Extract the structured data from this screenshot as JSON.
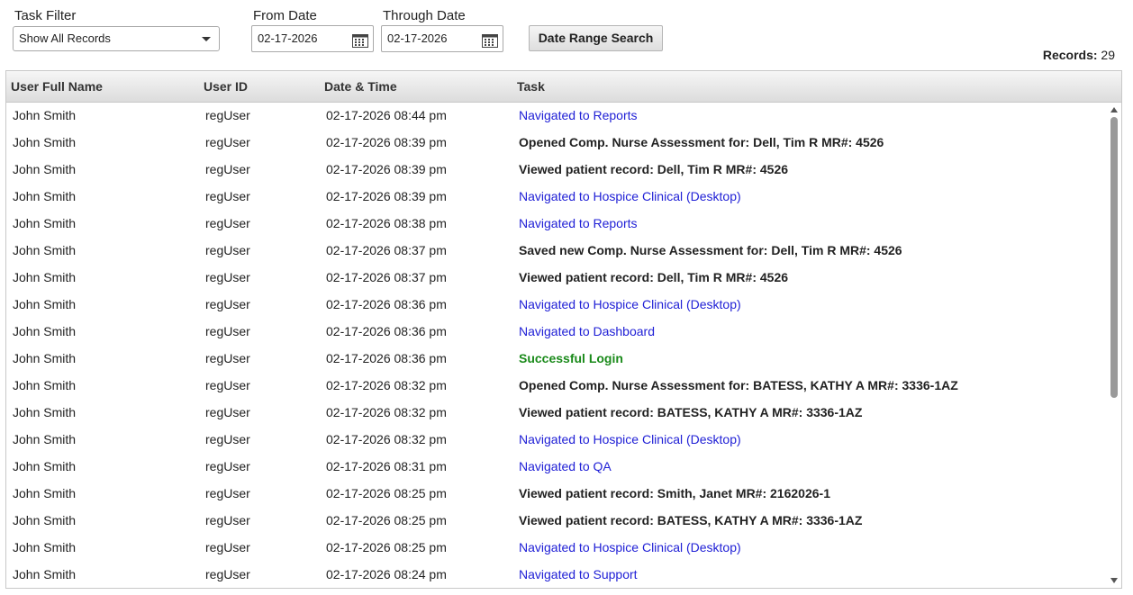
{
  "filters": {
    "task_filter_label": "Task Filter",
    "task_filter_value": "Show All Records",
    "from_date_label": "From Date",
    "from_date_value": "02-17-2026",
    "through_date_label": "Through Date",
    "through_date_value": "02-17-2026",
    "search_button": "Date Range Search"
  },
  "records": {
    "label": "Records:",
    "count": "29"
  },
  "table": {
    "headers": [
      "User Full Name",
      "User ID",
      "Date & Time",
      "Task"
    ],
    "rows": [
      {
        "name": "John Smith",
        "user_id": "regUser",
        "datetime": "02-17-2026 08:44 pm",
        "task": "Navigated to Reports",
        "style": "link"
      },
      {
        "name": "John Smith",
        "user_id": "regUser",
        "datetime": "02-17-2026 08:39 pm",
        "task": "Opened Comp. Nurse Assessment for: Dell, Tim R  MR#: 4526",
        "style": "bold"
      },
      {
        "name": "John Smith",
        "user_id": "regUser",
        "datetime": "02-17-2026 08:39 pm",
        "task": "Viewed patient record: Dell, Tim R  MR#: 4526",
        "style": "bold"
      },
      {
        "name": "John Smith",
        "user_id": "regUser",
        "datetime": "02-17-2026 08:39 pm",
        "task": "Navigated to Hospice Clinical (Desktop)",
        "style": "link"
      },
      {
        "name": "John Smith",
        "user_id": "regUser",
        "datetime": "02-17-2026 08:38 pm",
        "task": "Navigated to Reports",
        "style": "link"
      },
      {
        "name": "John Smith",
        "user_id": "regUser",
        "datetime": "02-17-2026 08:37 pm",
        "task": "Saved new Comp. Nurse Assessment for: Dell, Tim R  MR#: 4526",
        "style": "bold"
      },
      {
        "name": "John Smith",
        "user_id": "regUser",
        "datetime": "02-17-2026 08:37 pm",
        "task": "Viewed patient record: Dell, Tim R  MR#: 4526",
        "style": "bold"
      },
      {
        "name": "John Smith",
        "user_id": "regUser",
        "datetime": "02-17-2026 08:36 pm",
        "task": "Navigated to Hospice Clinical (Desktop)",
        "style": "link"
      },
      {
        "name": "John Smith",
        "user_id": "regUser",
        "datetime": "02-17-2026 08:36 pm",
        "task": "Navigated to Dashboard",
        "style": "link"
      },
      {
        "name": "John Smith",
        "user_id": "regUser",
        "datetime": "02-17-2026 08:36 pm",
        "task": "Successful Login",
        "style": "green"
      },
      {
        "name": "John Smith",
        "user_id": "regUser",
        "datetime": "02-17-2026 08:32 pm",
        "task": "Opened Comp. Nurse Assessment for: BATESS, KATHY A  MR#: 3336-1AZ",
        "style": "bold"
      },
      {
        "name": "John Smith",
        "user_id": "regUser",
        "datetime": "02-17-2026 08:32 pm",
        "task": "Viewed patient record: BATESS, KATHY A  MR#: 3336-1AZ",
        "style": "bold"
      },
      {
        "name": "John Smith",
        "user_id": "regUser",
        "datetime": "02-17-2026 08:32 pm",
        "task": "Navigated to Hospice Clinical (Desktop)",
        "style": "link"
      },
      {
        "name": "John Smith",
        "user_id": "regUser",
        "datetime": "02-17-2026 08:31 pm",
        "task": "Navigated to QA",
        "style": "link"
      },
      {
        "name": "John Smith",
        "user_id": "regUser",
        "datetime": "02-17-2026 08:25 pm",
        "task": "Viewed patient record: Smith, Janet  MR#: 2162026-1",
        "style": "bold"
      },
      {
        "name": "John Smith",
        "user_id": "regUser",
        "datetime": "02-17-2026 08:25 pm",
        "task": "Viewed patient record: BATESS, KATHY A  MR#: 3336-1AZ",
        "style": "bold"
      },
      {
        "name": "John Smith",
        "user_id": "regUser",
        "datetime": "02-17-2026 08:25 pm",
        "task": "Navigated to Hospice Clinical (Desktop)",
        "style": "link"
      },
      {
        "name": "John Smith",
        "user_id": "regUser",
        "datetime": "02-17-2026 08:24 pm",
        "task": "Navigated to Support",
        "style": "link"
      }
    ]
  },
  "colors": {
    "link": "#2020d6",
    "success": "#1a8a1a",
    "header_bg": "#dcdcdc"
  },
  "icons": {
    "calendar": "calendar-icon",
    "dropdown": "chevron-down-icon"
  }
}
